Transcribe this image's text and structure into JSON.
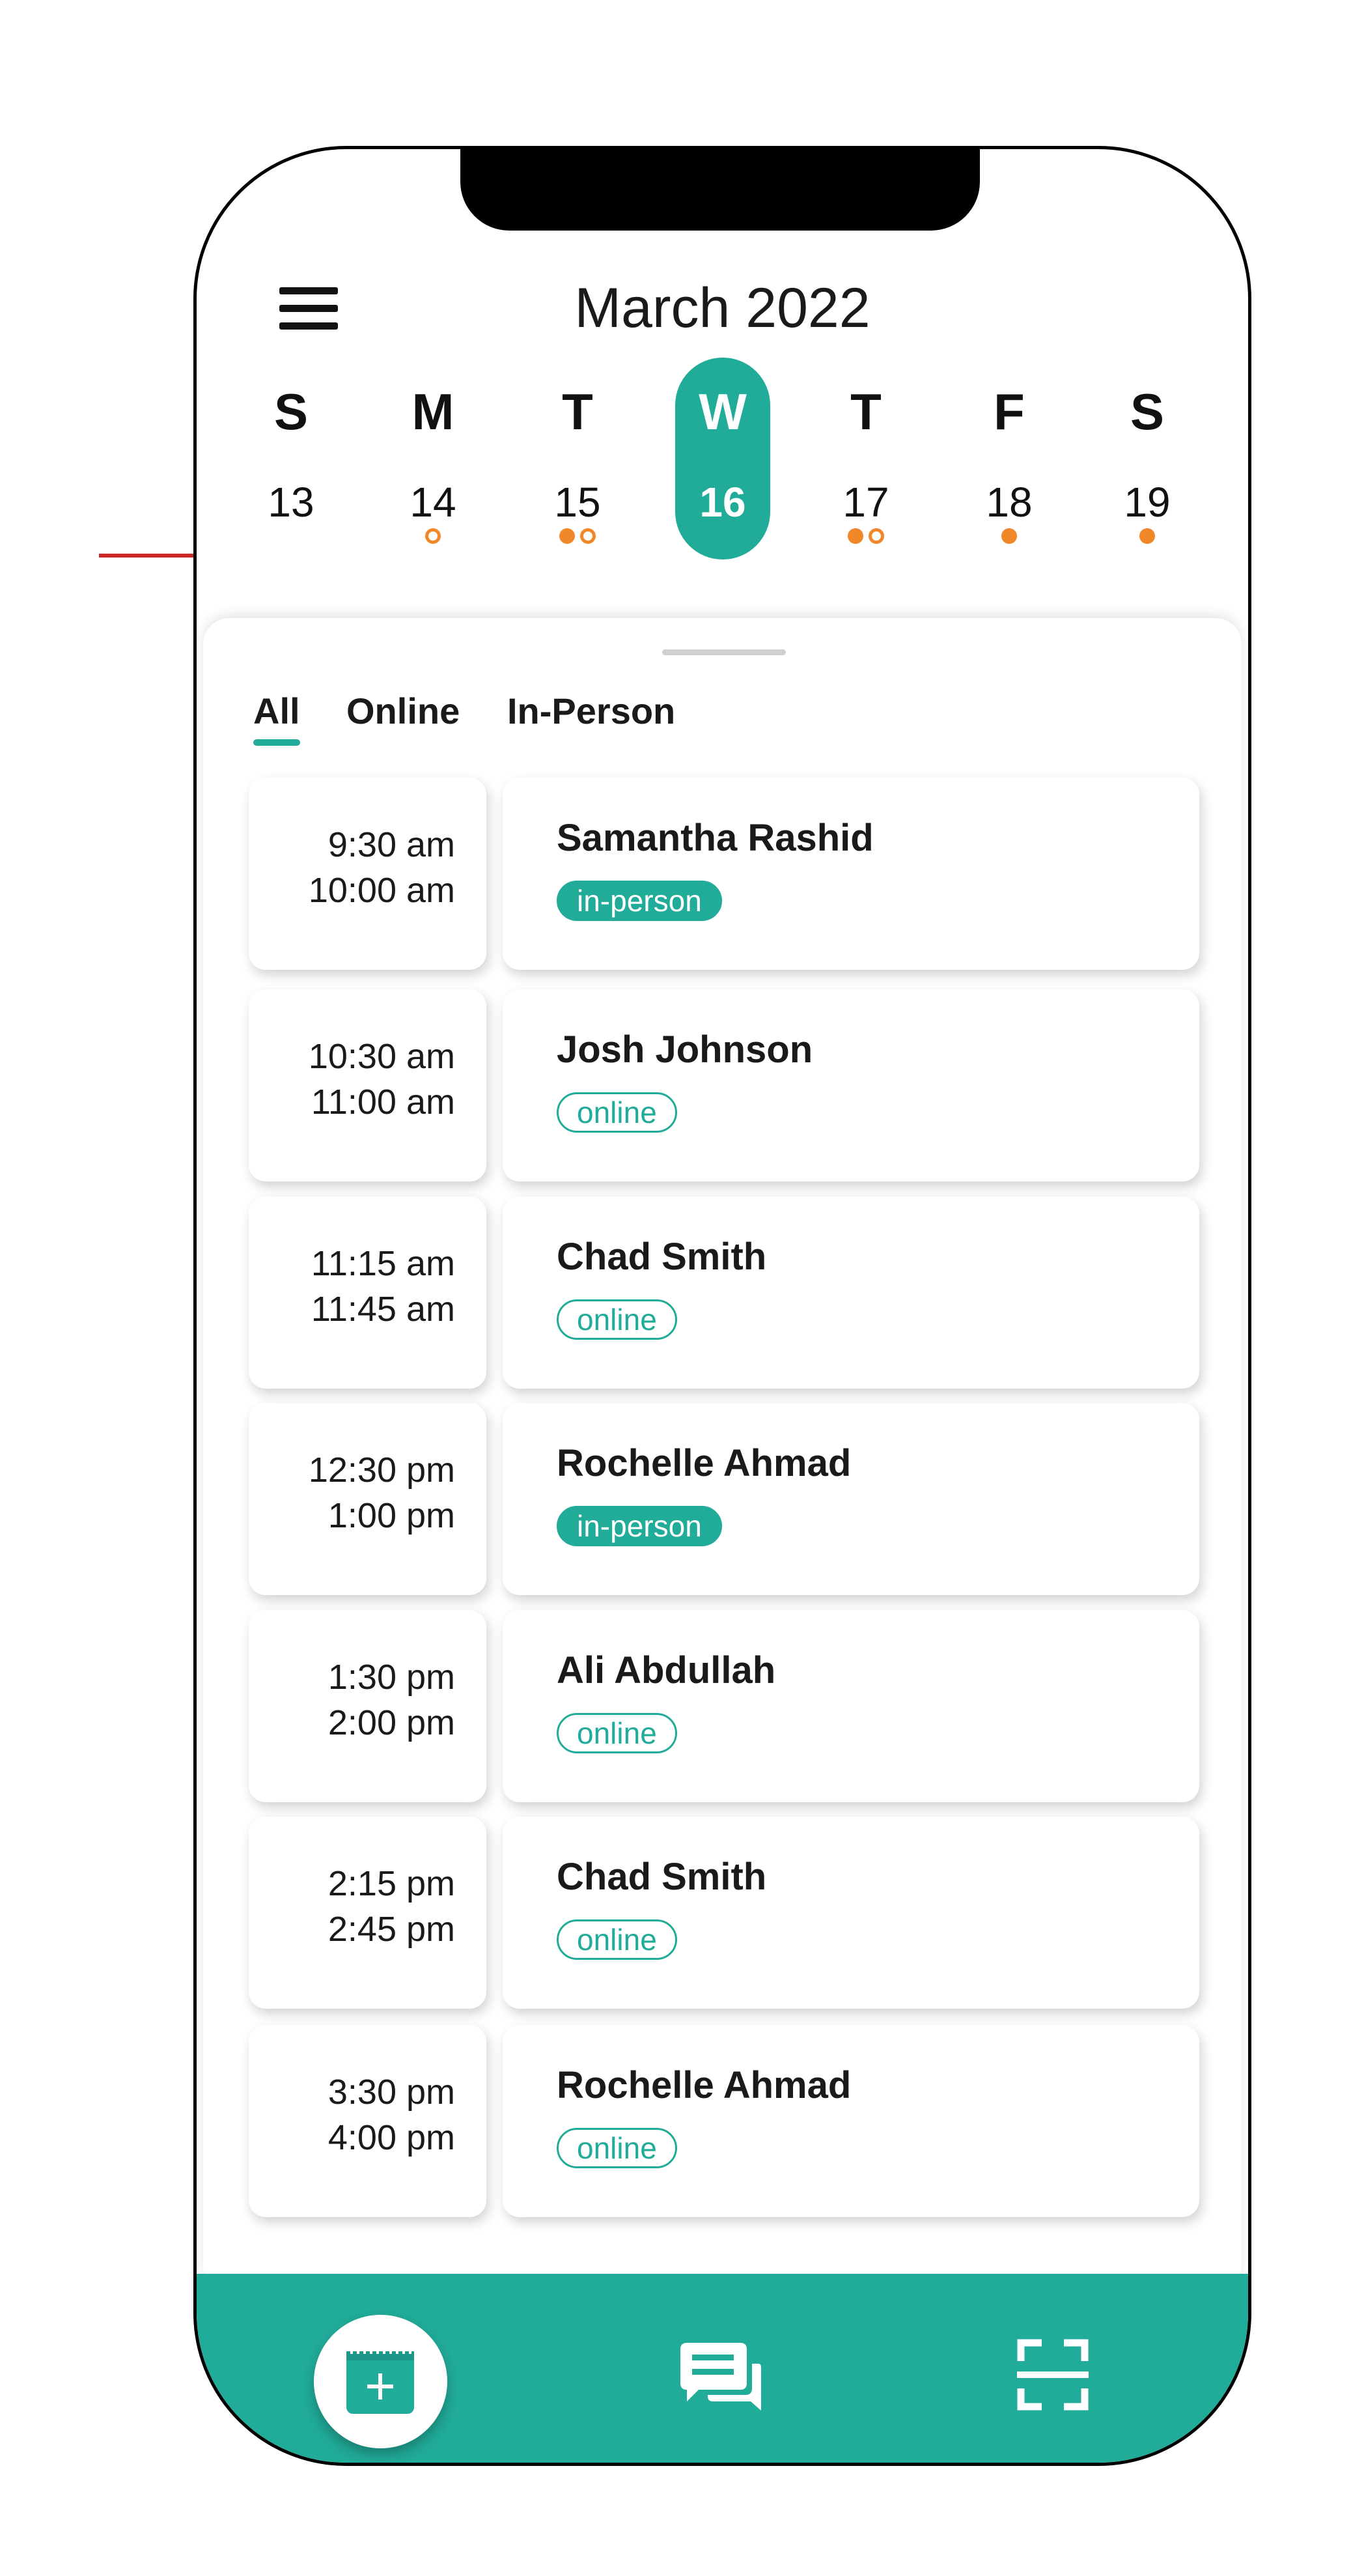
{
  "header": {
    "month_title": "March 2022"
  },
  "week": {
    "days": [
      {
        "dow": "S",
        "num": "13",
        "dots": []
      },
      {
        "dow": "M",
        "num": "14",
        "dots": [
          "hollow"
        ]
      },
      {
        "dow": "T",
        "num": "15",
        "dots": [
          "filled",
          "hollow"
        ]
      },
      {
        "dow": "W",
        "num": "16",
        "dots": [],
        "selected": true
      },
      {
        "dow": "T",
        "num": "17",
        "dots": [
          "filled",
          "hollow"
        ]
      },
      {
        "dow": "F",
        "num": "18",
        "dots": [
          "filled"
        ]
      },
      {
        "dow": "S",
        "num": "19",
        "dots": [
          "filled"
        ]
      }
    ]
  },
  "filters": {
    "tabs": [
      "All",
      "Online",
      "In-Person"
    ],
    "active": "All"
  },
  "appointments": [
    {
      "start": "9:30 am",
      "end": "10:00 am",
      "name": "Samantha Rashid",
      "type": "in-person"
    },
    {
      "start": "10:30 am",
      "end": "11:00 am",
      "name": "Josh Johnson",
      "type": "online"
    },
    {
      "start": "11:15 am",
      "end": "11:45 am",
      "name": "Chad Smith",
      "type": "online"
    },
    {
      "start": "12:30 pm",
      "end": "1:00 pm",
      "name": "Rochelle Ahmad",
      "type": "in-person"
    },
    {
      "start": "1:30 pm",
      "end": "2:00 pm",
      "name": "Ali Abdullah",
      "type": "online"
    },
    {
      "start": "2:15 pm",
      "end": "2:45 pm",
      "name": "Chad Smith",
      "type": "online"
    },
    {
      "start": "3:30 pm",
      "end": "4:00 pm",
      "name": "Rochelle Ahmad",
      "type": "online"
    }
  ],
  "bottom_nav": {
    "items": [
      "add-appointment-icon",
      "chat-icon",
      "scan-icon"
    ]
  },
  "colors": {
    "accent": "#21ab99",
    "event_dot": "#f0882a",
    "annotation_arrow": "#cc2a2a"
  }
}
